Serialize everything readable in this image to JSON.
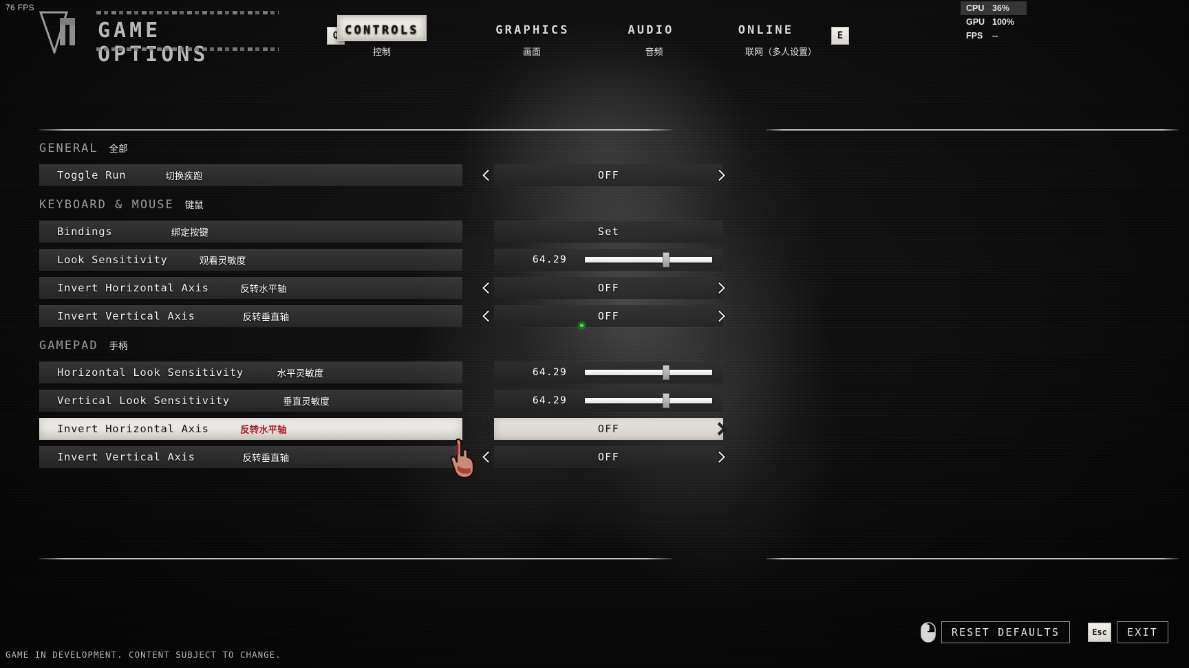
{
  "fps_counter": "76 FPS",
  "header": {
    "title": "GAME OPTIONS",
    "logo_icon": "vm-logo-icon"
  },
  "tabs": [
    {
      "key": "Q",
      "label": "CONTROLS",
      "cn": "控制",
      "selected": true
    },
    {
      "key": "",
      "label": "GRAPHICS",
      "cn": "画面",
      "selected": false
    },
    {
      "key": "",
      "label": "AUDIO",
      "cn": "音频",
      "selected": false
    },
    {
      "key": "E",
      "label": "ONLINE",
      "cn": "联网（多人设置）",
      "selected": false
    }
  ],
  "perf": {
    "cpu_label": "CPU",
    "cpu_value": "36%",
    "gpu_label": "GPU",
    "gpu_value": "100%",
    "fps_label": "FPS",
    "fps_value": "--"
  },
  "groups": [
    {
      "title": "GENERAL",
      "cn": "全部",
      "rows": [
        {
          "label": "Toggle Run",
          "cn": "切换疾跑",
          "type": "toggle",
          "value": "OFF",
          "selected": false
        }
      ]
    },
    {
      "title": "KEYBOARD & MOUSE",
      "cn": "键鼠",
      "rows": [
        {
          "label": "Bindings",
          "cn": "绑定按键",
          "type": "button",
          "value": "Set",
          "selected": false
        },
        {
          "label": "Look Sensitivity",
          "cn": "观看灵敏度",
          "type": "slider",
          "value": "64.29",
          "percent": 64.29,
          "selected": false
        },
        {
          "label": "Invert Horizontal Axis",
          "cn": "反转水平轴",
          "type": "toggle",
          "value": "OFF",
          "selected": false
        },
        {
          "label": "Invert Vertical Axis",
          "cn": "反转垂直轴",
          "type": "toggle",
          "value": "OFF",
          "selected": false,
          "indicator": "green"
        }
      ]
    },
    {
      "title": "GAMEPAD",
      "cn": "手柄",
      "rows": [
        {
          "label": "Horizontal Look Sensitivity",
          "cn": "水平灵敏度",
          "type": "slider",
          "value": "64.29",
          "percent": 64.29,
          "selected": false
        },
        {
          "label": "Vertical Look Sensitivity",
          "cn": "垂直灵敏度",
          "type": "slider",
          "value": "64.29",
          "percent": 64.29,
          "selected": false
        },
        {
          "label": "Invert Horizontal Axis",
          "cn": "反转水平轴",
          "type": "toggle",
          "value": "OFF",
          "selected": true
        },
        {
          "label": "Invert Vertical Axis",
          "cn": "反转垂直轴",
          "type": "toggle",
          "value": "OFF",
          "selected": false
        }
      ]
    }
  ],
  "footer": {
    "reset_label": "RESET DEFAULTS",
    "reset_icon": "mouse-icon",
    "exit_key": "Esc",
    "exit_label": "EXIT",
    "dev_notice": "GAME IN DEVELOPMENT. CONTENT SUBJECT TO CHANGE."
  },
  "cursor": {
    "icon": "bloody-hand-pointer-icon"
  },
  "colors": {
    "selected_cn": "#a81f1f",
    "indicator_green": "#3fdc4a",
    "panel": "#2f2f2f",
    "selected_bg": "#e8e6e1"
  }
}
